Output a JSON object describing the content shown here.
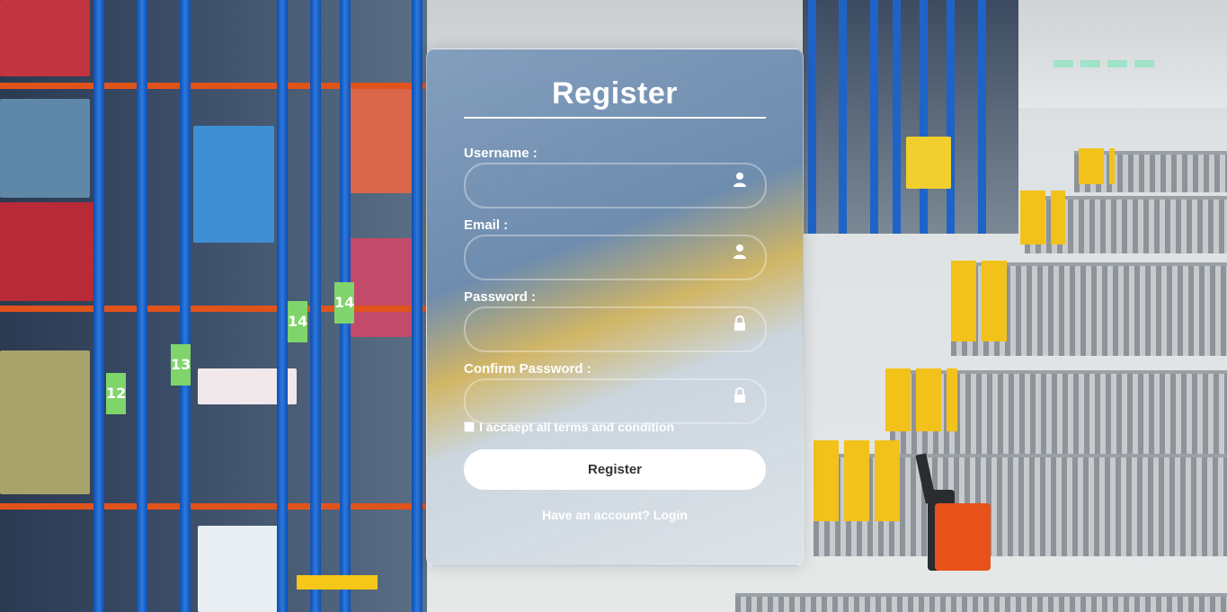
{
  "form": {
    "title": "Register",
    "fields": [
      {
        "label": "Username :",
        "value": "",
        "icon": "user-icon"
      },
      {
        "label": "Email :",
        "value": "",
        "icon": "user-icon"
      },
      {
        "label": "Password :",
        "value": "",
        "icon": "lock-icon"
      },
      {
        "label": "Confirm Password :",
        "value": "",
        "icon": "lock-icon"
      }
    ],
    "terms_label": "I accaept all terms and condition",
    "terms_checked": false,
    "submit_label": "Register",
    "login_prompt": "Have an account?",
    "login_link": "Login"
  },
  "background": {
    "rack_tags": [
      "12",
      "13",
      "14",
      "14"
    ]
  }
}
